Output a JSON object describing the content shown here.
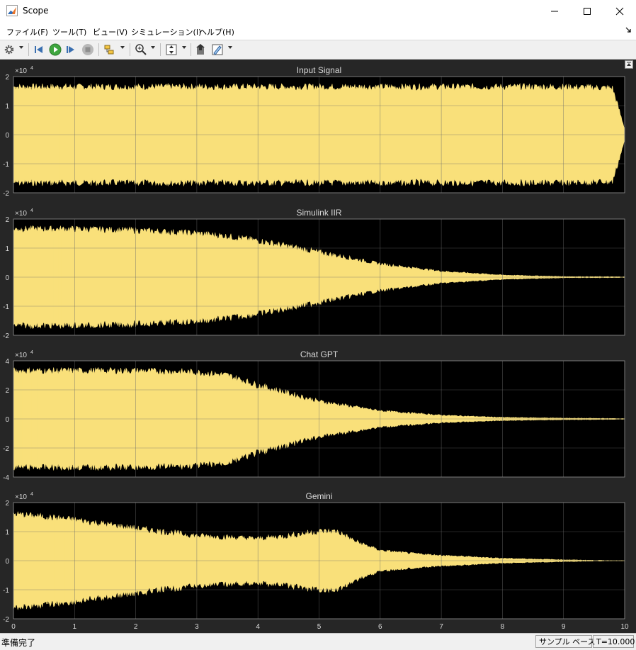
{
  "window": {
    "title": "Scope"
  },
  "menu": {
    "items": [
      "ファイル(F)",
      "ツール(T)",
      "ビュー(V)",
      "シミュレーション(I)",
      "ヘルプ(H)"
    ]
  },
  "toolbar": {
    "icons": [
      "gear-icon",
      "step-back-icon",
      "run-icon",
      "step-forward-icon",
      "stop-icon",
      "highlight-icon",
      "zoom-in-icon",
      "autoscale-icon",
      "write-data-icon",
      "style-icon"
    ]
  },
  "scope": {
    "background": "#262626",
    "axes_background": "#000000",
    "signal_color": "#f9e07a",
    "grid_color": "#6b6b6b",
    "text_color": "#d9d9d9"
  },
  "chart_data": [
    {
      "type": "line",
      "title": "Input Signal",
      "exponent_label": "×10",
      "exponent_power": "4",
      "xlim": [
        0,
        10
      ],
      "ylim": [
        -2,
        2
      ],
      "yticks": [
        "2",
        "1",
        "0",
        "-1",
        "-2"
      ],
      "xticks": [],
      "envelope": {
        "x": [
          0,
          0.5,
          1,
          2,
          3,
          4,
          5,
          6,
          7,
          8,
          9,
          9.8,
          10
        ],
        "upper": [
          1.64,
          1.64,
          1.64,
          1.64,
          1.64,
          1.64,
          1.64,
          1.64,
          1.64,
          1.64,
          1.64,
          1.6,
          0.2
        ],
        "lower": [
          -1.64,
          -1.64,
          -1.64,
          -1.64,
          -1.64,
          -1.64,
          -1.64,
          -1.64,
          -1.64,
          -1.64,
          -1.64,
          -1.6,
          -0.2
        ]
      }
    },
    {
      "type": "line",
      "title": "Simulink IIR",
      "exponent_label": "×10",
      "exponent_power": "4",
      "xlim": [
        0,
        10
      ],
      "ylim": [
        -2,
        2
      ],
      "yticks": [
        "2",
        "1",
        "0",
        "-1",
        "-2"
      ],
      "xticks": [],
      "envelope": {
        "x": [
          0,
          1,
          2,
          3,
          3.5,
          4,
          5,
          6,
          7,
          8,
          9,
          10
        ],
        "upper": [
          1.65,
          1.65,
          1.6,
          1.5,
          1.4,
          1.25,
          0.85,
          0.45,
          0.2,
          0.07,
          0.02,
          0.01
        ],
        "lower": [
          -1.65,
          -1.65,
          -1.6,
          -1.5,
          -1.4,
          -1.25,
          -0.85,
          -0.45,
          -0.2,
          -0.07,
          -0.02,
          -0.01
        ]
      }
    },
    {
      "type": "line",
      "title": "Chat GPT",
      "exponent_label": "×10",
      "exponent_power": "4",
      "xlim": [
        0,
        10
      ],
      "ylim": [
        -4,
        4
      ],
      "yticks": [
        "4",
        "2",
        "0",
        "-2",
        "-4"
      ],
      "xticks": [],
      "envelope": {
        "x": [
          0,
          1,
          2,
          3,
          3.5,
          4,
          5,
          6,
          7,
          8,
          9,
          10
        ],
        "upper": [
          3.3,
          3.3,
          3.3,
          3.2,
          3.0,
          2.3,
          1.2,
          0.55,
          0.25,
          0.1,
          0.05,
          0.02
        ],
        "lower": [
          -3.3,
          -3.3,
          -3.3,
          -3.2,
          -3.0,
          -2.3,
          -1.2,
          -0.55,
          -0.25,
          -0.1,
          -0.05,
          -0.02
        ]
      }
    },
    {
      "type": "line",
      "title": "Gemini",
      "exponent_label": "×10",
      "exponent_power": "4",
      "xlim": [
        0,
        10
      ],
      "ylim": [
        -2,
        2
      ],
      "yticks": [
        "2",
        "1",
        "0",
        "-1",
        "-2"
      ],
      "xticks": [
        "0",
        "1",
        "2",
        "3",
        "4",
        "5",
        "6",
        "7",
        "8",
        "9",
        "10"
      ],
      "envelope": {
        "x": [
          0,
          1,
          2,
          3,
          4,
          4.5,
          5,
          5.3,
          5.6,
          6,
          6.5,
          7,
          8,
          9,
          9.5,
          10
        ],
        "upper": [
          1.6,
          1.4,
          1.1,
          0.85,
          0.75,
          0.85,
          1.0,
          1.0,
          0.65,
          0.35,
          0.25,
          0.18,
          0.08,
          0.03,
          0.01,
          0.0
        ],
        "lower": [
          -1.6,
          -1.4,
          -1.1,
          -0.85,
          -0.75,
          -0.85,
          -1.0,
          -1.0,
          -0.65,
          -0.35,
          -0.25,
          -0.18,
          -0.08,
          -0.03,
          -0.01,
          0.0
        ]
      }
    }
  ],
  "status": {
    "left": "準備完了",
    "sample_mode": "サンプル ベース",
    "time": "T=10.000"
  }
}
